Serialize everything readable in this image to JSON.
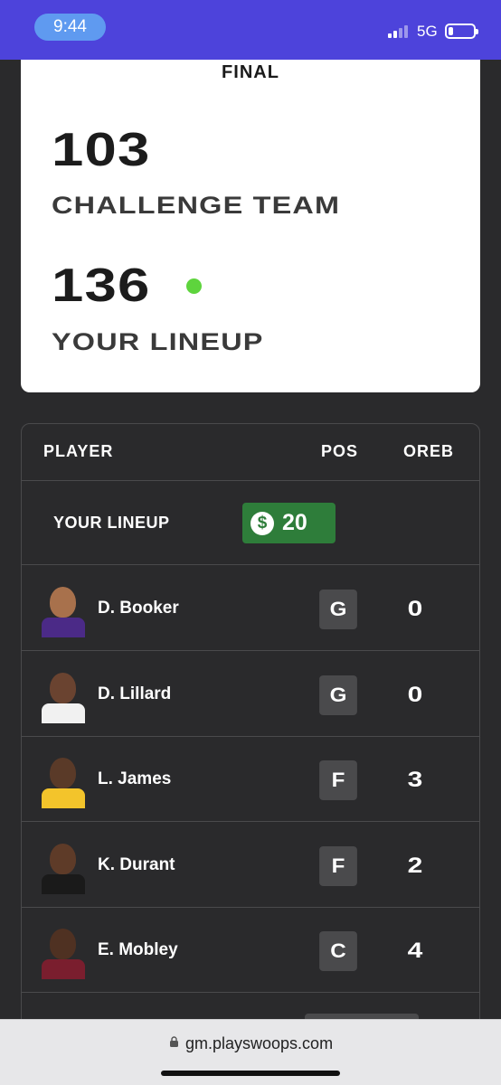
{
  "status_bar": {
    "time": "9:44",
    "network": "5G",
    "color": "#4d43db"
  },
  "score_card": {
    "status": "FINAL",
    "challenge_score": "103",
    "challenge_label": "CHALLENGE TEAM",
    "lineup_score": "136",
    "lineup_label": "YOUR LINEUP",
    "winner_indicator_color": "#5ed43d"
  },
  "table": {
    "headers": {
      "player": "PLAYER",
      "pos": "POS",
      "oreb": "OREB"
    },
    "lineup": {
      "label": "YOUR LINEUP",
      "budget_symbol": "$",
      "budget": "20",
      "budget_color": "#2e7d3a"
    },
    "players": [
      {
        "name": "D. Booker",
        "pos": "G",
        "oreb": "0",
        "jersey_color": "#4b2a87",
        "skin": "#a8714c"
      },
      {
        "name": "D. Lillard",
        "pos": "G",
        "oreb": "0",
        "jersey_color": "#f1f1f1",
        "skin": "#6a4330"
      },
      {
        "name": "L. James",
        "pos": "F",
        "oreb": "3",
        "jersey_color": "#f3c42b",
        "skin": "#5a3a28"
      },
      {
        "name": "K. Durant",
        "pos": "F",
        "oreb": "2",
        "jersey_color": "#1a1a1a",
        "skin": "#5e3b28"
      },
      {
        "name": "E. Mobley",
        "pos": "C",
        "oreb": "4",
        "jersey_color": "#7a1e2e",
        "skin": "#4f3122"
      }
    ]
  },
  "browser": {
    "url": "gm.playswoops.com"
  }
}
